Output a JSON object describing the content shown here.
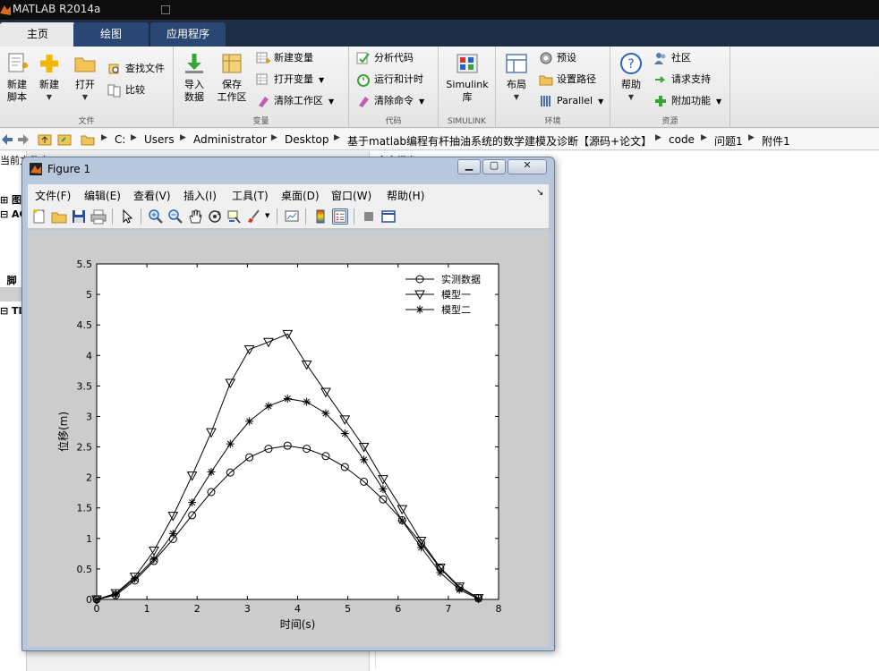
{
  "app": {
    "title": "MATLAB R2014a"
  },
  "ribbon_tabs": [
    {
      "label": "主页"
    },
    {
      "label": "绘图"
    },
    {
      "label": "应用程序"
    }
  ],
  "ribbon": {
    "file": {
      "group_label": "文件",
      "new_script": [
        "新建",
        "脚本"
      ],
      "new": "新建",
      "open": "打开",
      "find_files": "查找文件",
      "compare": "比较"
    },
    "variable": {
      "group_label": "变量",
      "import": [
        "导入",
        "数据"
      ],
      "save_ws": [
        "保存",
        "工作区"
      ],
      "new_var": "新建变量",
      "open_var": "打开变量",
      "clear_ws": "清除工作区"
    },
    "code": {
      "group_label": "代码",
      "analyze": "分析代码",
      "run_time": "运行和计时",
      "clear_cmd": "清除命令"
    },
    "simulink": {
      "group_label": "SIMULINK",
      "lib": [
        "Simulink",
        "库"
      ]
    },
    "env": {
      "group_label": "环境",
      "layout": "布局",
      "prefs": "预设",
      "set_path": "设置路径",
      "parallel": "Parallel"
    },
    "resources": {
      "group_label": "资源",
      "help": "帮助",
      "community": "社区",
      "support": "请求支持",
      "addons": "附加功能"
    }
  },
  "address": {
    "crumbs": [
      "C:",
      "Users",
      "Administrator",
      "Desktop",
      "基于matlab编程有杆抽油系统的数学建模及诊断【源码+论文】",
      "code",
      "问题1",
      "附件1"
    ]
  },
  "left_panel": {
    "header": "当前文件夹",
    "rows": [
      "图",
      "AG",
      "脚",
      "TI"
    ]
  },
  "command_panel": {
    "header": "命令行窗口"
  },
  "figure": {
    "title": "Figure 1",
    "menu": [
      "文件(F)",
      "编辑(E)",
      "查看(V)",
      "插入(I)",
      "工具(T)",
      "桌面(D)",
      "窗口(W)",
      "帮助(H)"
    ]
  },
  "chart_data": {
    "type": "line",
    "title": "",
    "xlabel": "时间(s)",
    "ylabel": "位移(m)",
    "xlim": [
      0,
      8
    ],
    "ylim": [
      0,
      5.5
    ],
    "xticks": [
      0,
      1,
      2,
      3,
      4,
      5,
      6,
      7,
      8
    ],
    "yticks": [
      0,
      0.5,
      1,
      1.5,
      2,
      2.5,
      3,
      3.5,
      4,
      4.5,
      5,
      5.5
    ],
    "legend_position": "top-right",
    "grid": false,
    "x": [
      0,
      0.38,
      0.76,
      1.14,
      1.52,
      1.9,
      2.28,
      2.66,
      3.04,
      3.42,
      3.8,
      4.18,
      4.56,
      4.94,
      5.32,
      5.7,
      6.08,
      6.46,
      6.84,
      7.22,
      7.6
    ],
    "series": [
      {
        "name": "实测数据",
        "marker": "circle",
        "values": [
          0,
          0.07,
          0.31,
          0.63,
          0.99,
          1.38,
          1.76,
          2.08,
          2.33,
          2.47,
          2.52,
          2.47,
          2.35,
          2.17,
          1.93,
          1.64,
          1.3,
          0.92,
          0.51,
          0.19,
          0.02
        ]
      },
      {
        "name": "模型一",
        "marker": "triangle-down",
        "values": [
          0,
          0.1,
          0.37,
          0.8,
          1.37,
          2.03,
          2.74,
          3.55,
          4.1,
          4.22,
          4.35,
          3.85,
          3.4,
          2.95,
          2.5,
          1.97,
          1.48,
          0.96,
          0.52,
          0.21,
          0.02
        ]
      },
      {
        "name": "模型二",
        "marker": "star",
        "values": [
          0,
          0.09,
          0.34,
          0.66,
          1.08,
          1.59,
          2.09,
          2.55,
          2.92,
          3.17,
          3.29,
          3.24,
          3.05,
          2.72,
          2.29,
          1.81,
          1.29,
          0.85,
          0.44,
          0.16,
          0.01
        ]
      }
    ]
  }
}
